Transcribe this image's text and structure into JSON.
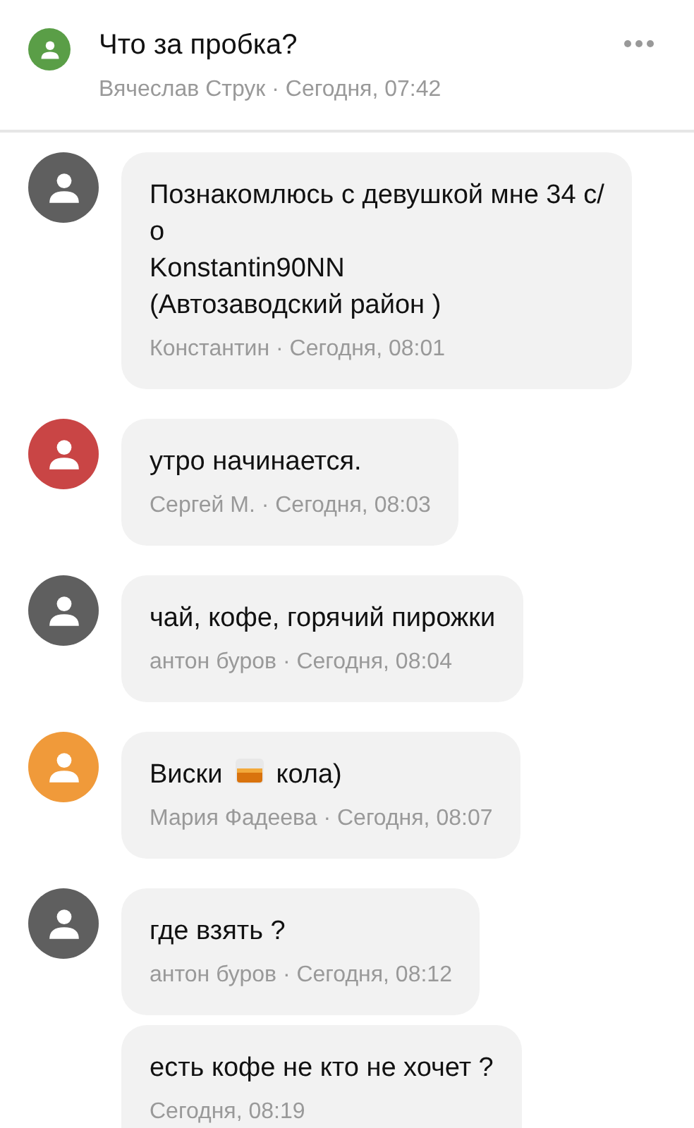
{
  "post": {
    "title": "Что за пробка?",
    "meta": "Вячеслав Струк · Сегодня, 07:42",
    "color": "#5a9e47"
  },
  "comments": [
    {
      "color": "#5f5f5f",
      "messages": [
        {
          "text": "Познакомлюсь с девушкой мне 34 с/\nо\nKonstantin90NN\n(Автозаводский район )",
          "meta": "Константин · Сегодня, 08:01"
        }
      ]
    },
    {
      "color": "#c94545",
      "messages": [
        {
          "text": "утро начинается.",
          "meta": "Сергей М. · Сегодня, 08:03"
        }
      ]
    },
    {
      "color": "#5f5f5f",
      "messages": [
        {
          "text": "чай, кофе, горячий пирожки",
          "meta": "антон буров · Сегодня, 08:04"
        }
      ]
    },
    {
      "color": "#f09a3a",
      "messages": [
        {
          "text": "Виски",
          "emoji": true,
          "text_after": "кола)",
          "meta": "Мария Фадеева · Сегодня, 08:07"
        }
      ]
    },
    {
      "color": "#5f5f5f",
      "messages": [
        {
          "text": "где взять ?",
          "meta": "антон буров · Сегодня, 08:12"
        },
        {
          "text": "есть кофе не кто не хочет ?",
          "meta": "Сегодня, 08:19"
        }
      ]
    }
  ]
}
